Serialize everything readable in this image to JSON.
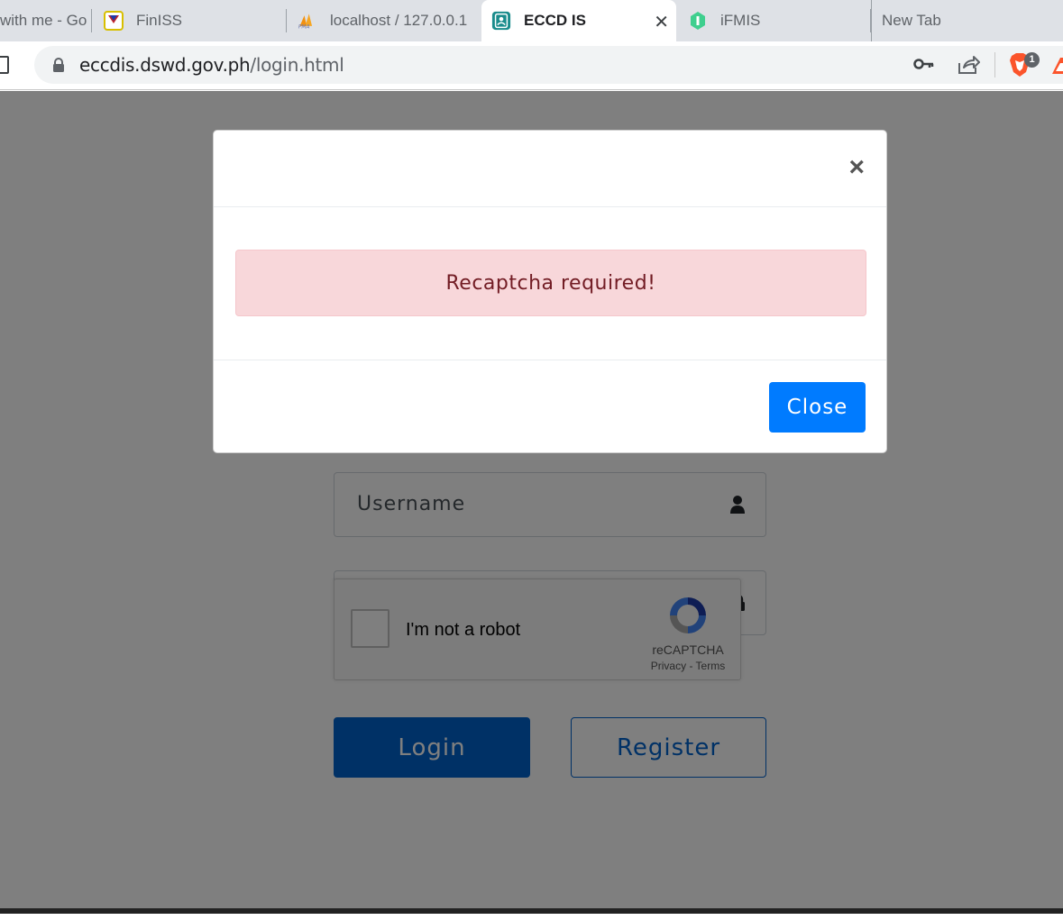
{
  "browser": {
    "tabs": [
      {
        "label": "with me - Go",
        "active": false
      },
      {
        "label": "FinISS",
        "active": false
      },
      {
        "label": "localhost / 127.0.0.1",
        "active": false
      },
      {
        "label": "ECCD IS",
        "active": true
      },
      {
        "label": "iFMIS",
        "active": false
      },
      {
        "label": "New Tab",
        "active": false
      }
    ],
    "tab_close_glyph": "✕",
    "url_domain": "eccdis.dswd.gov.ph",
    "url_path": "/login.html",
    "brave_badge": "1"
  },
  "login_form": {
    "username_placeholder": "Username",
    "password_value": "**********",
    "recaptcha": {
      "label": "I'm not a robot",
      "brand": "reCAPTCHA",
      "links": "Privacy - Terms"
    },
    "login_label": "Login",
    "register_label": "Register",
    "accent_color": "#0062cc"
  },
  "modal": {
    "close_glyph": "×",
    "alert_message": "Recaptcha required!",
    "close_button_label": "Close",
    "alert_color": "#f8d7da",
    "button_color": "#007bff"
  }
}
